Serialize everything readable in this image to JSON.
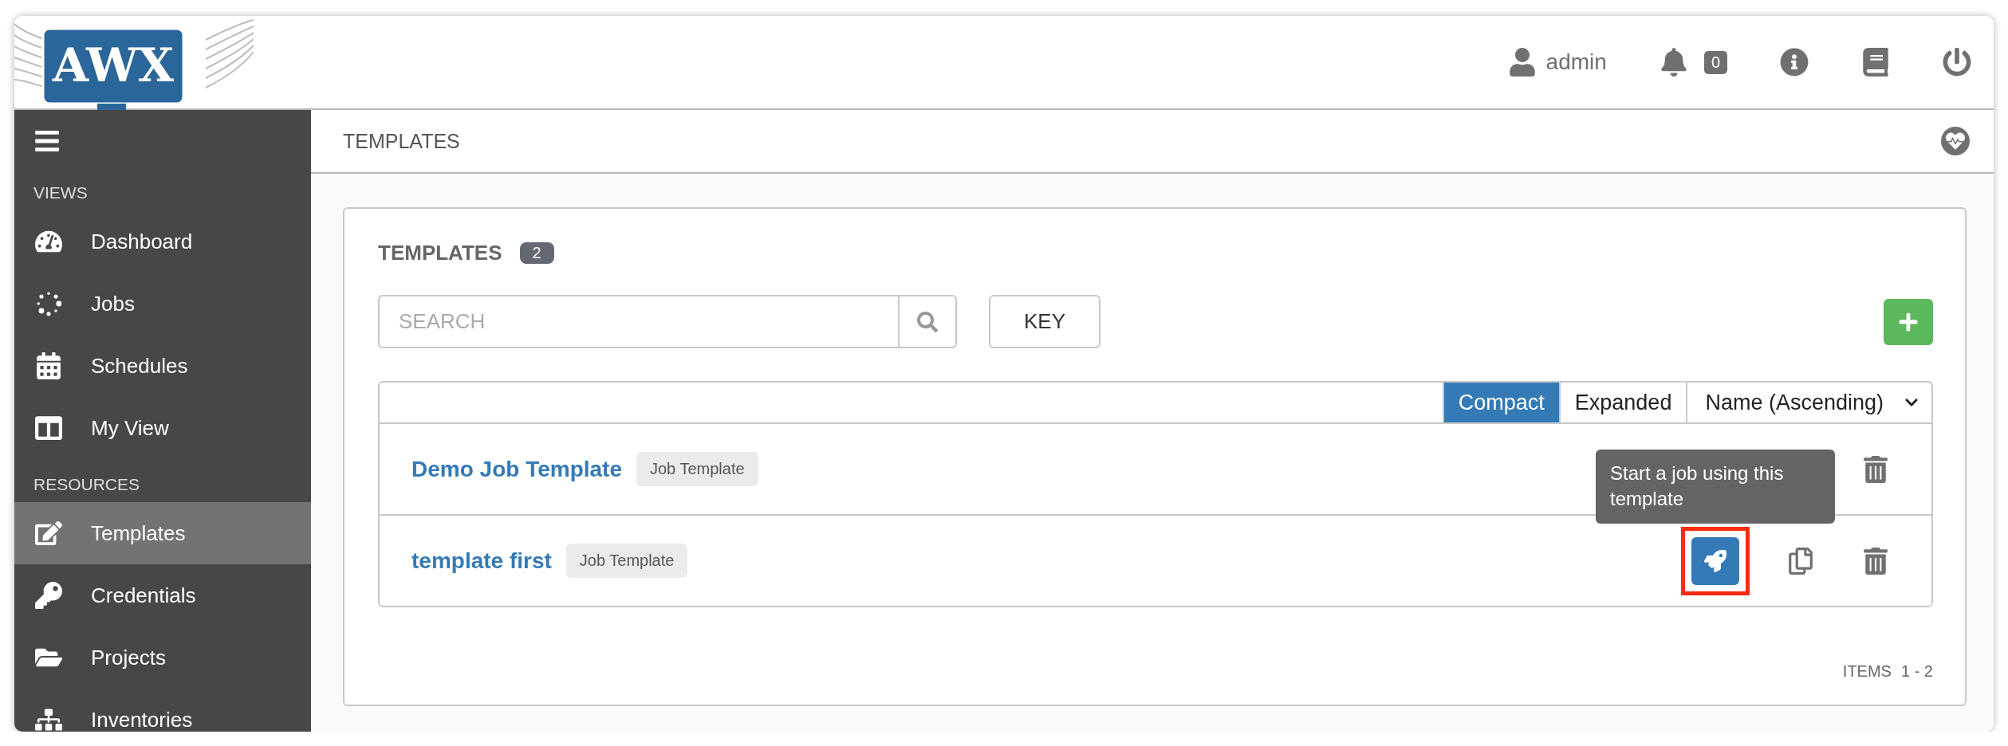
{
  "logo": {
    "text": "AWX"
  },
  "header": {
    "user": "admin",
    "notifications": "0"
  },
  "sidebar": {
    "sections": [
      {
        "title": "VIEWS",
        "items": [
          {
            "label": "Dashboard",
            "selected": false
          },
          {
            "label": "Jobs",
            "selected": false
          },
          {
            "label": "Schedules",
            "selected": false
          },
          {
            "label": "My View",
            "selected": false
          }
        ]
      },
      {
        "title": "RESOURCES",
        "items": [
          {
            "label": "Templates",
            "selected": true
          },
          {
            "label": "Credentials",
            "selected": false
          },
          {
            "label": "Projects",
            "selected": false
          },
          {
            "label": "Inventories",
            "selected": false
          }
        ]
      }
    ]
  },
  "breadcrumb": "TEMPLATES",
  "panel": {
    "title": "TEMPLATES",
    "count": "2",
    "search": {
      "placeholder": "SEARCH"
    },
    "key_button": "KEY",
    "view_toggle": [
      {
        "label": "Compact",
        "selected": true
      },
      {
        "label": "Expanded",
        "selected": false
      }
    ],
    "sort": "Name (Ascending)",
    "rows": [
      {
        "name": "Demo Job Template",
        "type": "Job Template",
        "actions": [
          {
            "kind": "delete",
            "highlighted": false
          }
        ]
      },
      {
        "name": "template first",
        "type": "Job Template",
        "actions": [
          {
            "kind": "launch",
            "highlighted": true,
            "tooltip": "Start a job using this template"
          },
          {
            "kind": "copy",
            "highlighted": false
          },
          {
            "kind": "delete",
            "highlighted": false
          }
        ]
      }
    ],
    "items_label": "ITEMS",
    "items_range": "1 - 2"
  }
}
